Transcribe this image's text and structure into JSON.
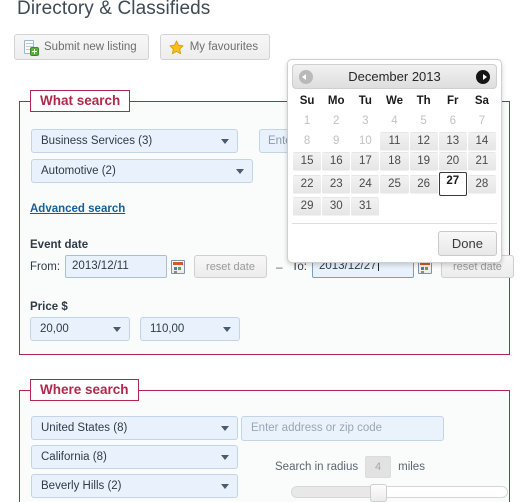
{
  "header": {
    "title": "Directory & Classifieds",
    "buttons": [
      {
        "label": "Submit new listing",
        "icon": "document-add-icon"
      },
      {
        "label": "My favourites",
        "icon": "star-icon"
      }
    ]
  },
  "what_search": {
    "legend": "What search",
    "category_primary": "Business Services (3)",
    "category_secondary": "Automotive (2)",
    "keyword_placeholder": "Enter keyword",
    "advanced_link": "Advanced search",
    "event_date_label": "Event date",
    "from_label": "From:",
    "from_value": "2013/12/11",
    "to_label": "To:",
    "to_value": "2013/12/27",
    "separator": "–",
    "reset_label": "reset date",
    "price_label": "Price $",
    "price_min": "20,00",
    "price_max": "110,00"
  },
  "where_search": {
    "legend": "Where search",
    "country": "United States (8)",
    "state": "California (8)",
    "city": "Beverly Hills (2)",
    "address_placeholder": "Enter address or zip code",
    "radius_prefix": "Search in radius",
    "radius_value": "4",
    "radius_unit": "miles",
    "radius_percent": 40
  },
  "calendar": {
    "title": "December 2013",
    "prev_icon": "chevron-left-icon",
    "next_icon": "chevron-right-icon",
    "weekdays": [
      "Su",
      "Mo",
      "Tu",
      "We",
      "Th",
      "Fr",
      "Sa"
    ],
    "weeks": [
      [
        {
          "d": "1",
          "state": "disabled"
        },
        {
          "d": "2",
          "state": "disabled"
        },
        {
          "d": "3",
          "state": "disabled"
        },
        {
          "d": "4",
          "state": "disabled"
        },
        {
          "d": "5",
          "state": "disabled"
        },
        {
          "d": "6",
          "state": "disabled"
        },
        {
          "d": "7",
          "state": "disabled"
        }
      ],
      [
        {
          "d": "8",
          "state": "disabled"
        },
        {
          "d": "9",
          "state": "disabled"
        },
        {
          "d": "10",
          "state": "disabled"
        },
        {
          "d": "11",
          "state": "enabled"
        },
        {
          "d": "12",
          "state": "enabled"
        },
        {
          "d": "13",
          "state": "enabled"
        },
        {
          "d": "14",
          "state": "enabled"
        }
      ],
      [
        {
          "d": "15",
          "state": "enabled"
        },
        {
          "d": "16",
          "state": "enabled"
        },
        {
          "d": "17",
          "state": "enabled"
        },
        {
          "d": "18",
          "state": "enabled"
        },
        {
          "d": "19",
          "state": "enabled"
        },
        {
          "d": "20",
          "state": "enabled"
        },
        {
          "d": "21",
          "state": "enabled"
        }
      ],
      [
        {
          "d": "22",
          "state": "enabled"
        },
        {
          "d": "23",
          "state": "enabled"
        },
        {
          "d": "24",
          "state": "enabled"
        },
        {
          "d": "25",
          "state": "enabled"
        },
        {
          "d": "26",
          "state": "enabled"
        },
        {
          "d": "27",
          "state": "selected"
        },
        {
          "d": "28",
          "state": "enabled"
        }
      ],
      [
        {
          "d": "29",
          "state": "enabled"
        },
        {
          "d": "30",
          "state": "enabled"
        },
        {
          "d": "31",
          "state": "enabled"
        },
        {
          "d": "",
          "state": "empty"
        },
        {
          "d": "",
          "state": "empty"
        },
        {
          "d": "",
          "state": "empty"
        },
        {
          "d": "",
          "state": "empty"
        }
      ]
    ],
    "done_label": "Done"
  },
  "colors": {
    "accent": "#b0284b",
    "link": "#13609c",
    "select_bg": "#e9f2fc",
    "fieldset_bg": "#f9fcfb",
    "title": "#3f4a56"
  }
}
